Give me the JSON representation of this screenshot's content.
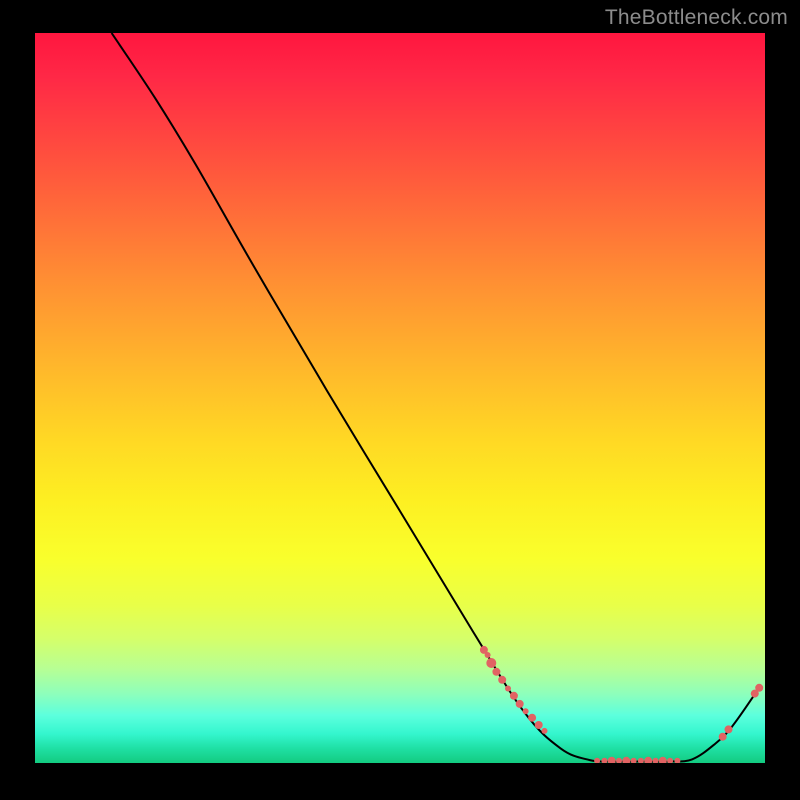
{
  "watermark": "TheBottleneck.com",
  "chart_data": {
    "type": "line",
    "title": "",
    "xlabel": "",
    "ylabel": "",
    "x_range": [
      0,
      100
    ],
    "y_range": [
      0,
      100
    ],
    "line": {
      "color": "#000000",
      "x": [
        10.5,
        16.5,
        22.0,
        30.0,
        40.0,
        50.0,
        60.0,
        67.0,
        72.0,
        76.0,
        79.0,
        83.0,
        87.0,
        90.0,
        93.0,
        95.5,
        99.0
      ],
      "y": [
        100.0,
        91.0,
        82.0,
        68.0,
        51.0,
        34.5,
        18.0,
        7.0,
        2.0,
        0.4,
        0.2,
        0.2,
        0.2,
        0.5,
        2.5,
        5.0,
        10.0
      ]
    },
    "marker_color": "#e16363",
    "markers": [
      {
        "x": 61.5,
        "y": 15.5,
        "r": 4
      },
      {
        "x": 62.0,
        "y": 14.8,
        "r": 3
      },
      {
        "x": 62.5,
        "y": 13.7,
        "r": 5
      },
      {
        "x": 63.2,
        "y": 12.5,
        "r": 4
      },
      {
        "x": 64.0,
        "y": 11.4,
        "r": 4
      },
      {
        "x": 64.8,
        "y": 10.2,
        "r": 3
      },
      {
        "x": 65.6,
        "y": 9.2,
        "r": 4
      },
      {
        "x": 66.4,
        "y": 8.1,
        "r": 4
      },
      {
        "x": 67.2,
        "y": 7.1,
        "r": 3
      },
      {
        "x": 68.1,
        "y": 6.2,
        "r": 4
      },
      {
        "x": 69.0,
        "y": 5.2,
        "r": 4
      },
      {
        "x": 69.8,
        "y": 4.4,
        "r": 3
      },
      {
        "x": 77.0,
        "y": 0.3,
        "r": 3
      },
      {
        "x": 78.0,
        "y": 0.3,
        "r": 3
      },
      {
        "x": 79.0,
        "y": 0.3,
        "r": 4
      },
      {
        "x": 80.0,
        "y": 0.3,
        "r": 3
      },
      {
        "x": 81.0,
        "y": 0.3,
        "r": 4
      },
      {
        "x": 82.0,
        "y": 0.3,
        "r": 3
      },
      {
        "x": 83.0,
        "y": 0.3,
        "r": 3
      },
      {
        "x": 84.0,
        "y": 0.3,
        "r": 4
      },
      {
        "x": 85.0,
        "y": 0.3,
        "r": 3
      },
      {
        "x": 86.0,
        "y": 0.3,
        "r": 4
      },
      {
        "x": 87.0,
        "y": 0.3,
        "r": 3
      },
      {
        "x": 88.0,
        "y": 0.3,
        "r": 3
      },
      {
        "x": 94.2,
        "y": 3.6,
        "r": 4
      },
      {
        "x": 95.0,
        "y": 4.6,
        "r": 4
      },
      {
        "x": 98.6,
        "y": 9.5,
        "r": 4
      },
      {
        "x": 99.2,
        "y": 10.3,
        "r": 4
      }
    ]
  }
}
